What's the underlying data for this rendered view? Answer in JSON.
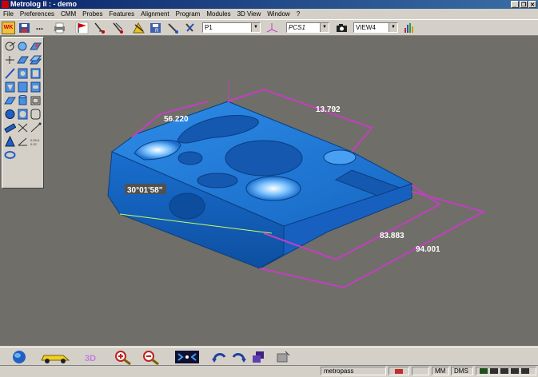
{
  "window": {
    "title": "Metrolog II : - demo"
  },
  "menu": [
    "File",
    "Preferences",
    "CMM",
    "Probes",
    "Features",
    "Alignment",
    "Program",
    "Modules",
    "3D View",
    "Window",
    "?"
  ],
  "toolbar": {
    "wk_label": "WK",
    "ellipsis": "...",
    "point_select": "P1",
    "pcs_select": "PCS1",
    "view_select": "VIEW4"
  },
  "palette": {
    "tools": [
      "probe-tool",
      "sphere-probe-tool",
      "point-tool",
      "plane-tool",
      "line-tool",
      "circle-tool",
      "cylinder-tool",
      "cone-tool",
      "sphere-tool",
      "distance-tool",
      "angle-tool",
      "torus-tool",
      "ellipse-tool",
      "curve-tool",
      "slot-tool",
      "square-tool",
      "rectangle-tool",
      "section-tool",
      "projection-tool",
      "symmetry-tool",
      "intersection-tool",
      "tolerance-tool",
      "position-tool",
      "profile-tool"
    ]
  },
  "viewport": {
    "dimensions": {
      "d1": "56.220",
      "d2": "13.792",
      "d3": "83.883",
      "d4": "94.001"
    },
    "angle_label": "30°01'58\""
  },
  "statusbar": {
    "user": "metropass",
    "units": "MM",
    "angle_format": "DMS"
  },
  "colors": {
    "part": "#1e7ad6",
    "dimension": "#c040c0",
    "background": "#706e68"
  }
}
